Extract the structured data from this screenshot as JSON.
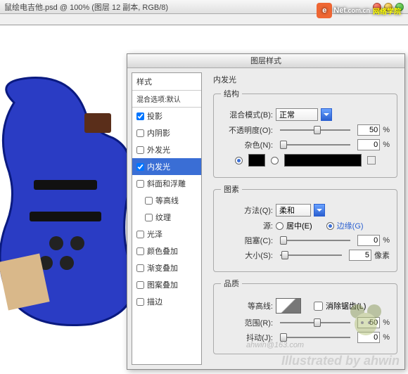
{
  "titlebar": {
    "document_title": "鼠绘电吉他.psd @ 100% (图层 12 副本, RGB/8)"
  },
  "watermark": {
    "logo_e": "e",
    "logo_net": "Net",
    "logo_sub": ".com.cn",
    "chn": "网络学院"
  },
  "dialog": {
    "title": "图层样式"
  },
  "styles": {
    "header": "样式",
    "blend_options": "混合选项:默认",
    "items": [
      {
        "label": "投影",
        "checked": true,
        "selected": false,
        "indent": false
      },
      {
        "label": "内阴影",
        "checked": false,
        "selected": false,
        "indent": false
      },
      {
        "label": "外发光",
        "checked": false,
        "selected": false,
        "indent": false
      },
      {
        "label": "内发光",
        "checked": true,
        "selected": true,
        "indent": false
      },
      {
        "label": "斜面和浮雕",
        "checked": false,
        "selected": false,
        "indent": false
      },
      {
        "label": "等高线",
        "checked": false,
        "selected": false,
        "indent": true
      },
      {
        "label": "纹理",
        "checked": false,
        "selected": false,
        "indent": true
      },
      {
        "label": "光泽",
        "checked": false,
        "selected": false,
        "indent": false
      },
      {
        "label": "颜色叠加",
        "checked": false,
        "selected": false,
        "indent": false
      },
      {
        "label": "渐变叠加",
        "checked": false,
        "selected": false,
        "indent": false
      },
      {
        "label": "图案叠加",
        "checked": false,
        "selected": false,
        "indent": false
      },
      {
        "label": "描边",
        "checked": false,
        "selected": false,
        "indent": false
      }
    ]
  },
  "panel": {
    "section_title": "内发光",
    "structure": {
      "legend": "结构",
      "blend_mode_label": "混合模式(B):",
      "blend_mode_value": "正常",
      "opacity_label": "不透明度(O):",
      "opacity_value": "50",
      "opacity_unit": "%",
      "noise_label": "杂色(N):",
      "noise_value": "0",
      "noise_unit": "%"
    },
    "elements": {
      "legend": "图素",
      "technique_label": "方法(Q):",
      "technique_value": "柔和",
      "source_label": "源:",
      "source_center": "居中(E)",
      "source_edge": "边缘(G)",
      "choke_label": "阻塞(C):",
      "choke_value": "0",
      "choke_unit": "%",
      "size_label": "大小(S):",
      "size_value": "5",
      "size_unit": "像素"
    },
    "quality": {
      "legend": "品质",
      "contour_label": "等高线:",
      "antialias_label": "消除锯齿(L)",
      "range_label": "范围(R):",
      "range_value": "50",
      "range_unit": "%",
      "jitter_label": "抖动(J):",
      "jitter_value": "0",
      "jitter_unit": "%"
    }
  },
  "credit": "ahwin@163.com",
  "illustrated": "Illustrated by ahwin"
}
